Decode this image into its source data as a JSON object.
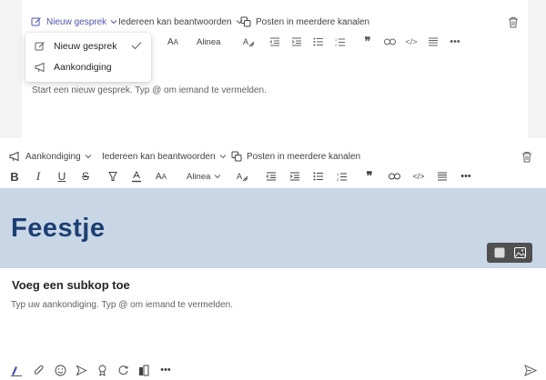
{
  "top_compose": {
    "post_type": "Nieuw gesprek",
    "reply_setting": "Iedereen kan beantwoorden",
    "multi_channel": "Posten in meerdere kanalen",
    "paragraph_style": "Alinea",
    "placeholder": "Start een nieuw gesprek. Typ @ om iemand te vermelden."
  },
  "post_type_menu": {
    "items": [
      {
        "label": "Nieuw gesprek",
        "checked": true,
        "icon": "compose-icon"
      },
      {
        "label": "Aankondiging",
        "checked": false,
        "icon": "megaphone-icon"
      }
    ]
  },
  "bottom_compose": {
    "post_type": "Aankondiging",
    "reply_setting": "Iedereen kan beantwoorden",
    "multi_channel": "Posten in meerdere kanalen",
    "paragraph_style": "Alinea",
    "headline": "Feestje",
    "subheading_placeholder": "Voeg een subkop toe",
    "placeholder": "Typ uw aankondiging. Typ @ om iemand te vermelden."
  },
  "colors": {
    "accent": "#4f52b2",
    "banner_bg": "#c8d6e6",
    "headline": "#1c3f73"
  }
}
